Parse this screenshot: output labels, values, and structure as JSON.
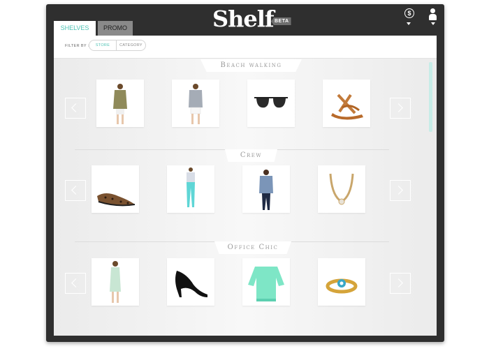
{
  "header": {
    "brand": "Shelf",
    "badge": "BETA"
  },
  "tabs": [
    {
      "label": "SHELVES"
    },
    {
      "label": "PROMO"
    }
  ],
  "filter": {
    "label": "FILTER BY :",
    "options": [
      "STORE",
      "CATEGORY"
    ],
    "selected": "STORE"
  },
  "shelves": [
    {
      "title": "Beach walking",
      "items": [
        {
          "name": "olive-utility-jacket-outfit"
        },
        {
          "name": "gray-cardigan-white-shorts-outfit"
        },
        {
          "name": "black-sunglasses"
        },
        {
          "name": "tan-strappy-sandals"
        }
      ]
    },
    {
      "title": "Crew",
      "items": [
        {
          "name": "leopard-print-flats"
        },
        {
          "name": "turquoise-skinny-pants"
        },
        {
          "name": "chambray-shirt-outfit"
        },
        {
          "name": "statement-necklace"
        }
      ]
    },
    {
      "title": "Office Chic",
      "items": [
        {
          "name": "mint-sheath-dress"
        },
        {
          "name": "black-patent-pumps"
        },
        {
          "name": "mint-sweater"
        },
        {
          "name": "jeweled-bracelet"
        }
      ]
    }
  ],
  "colors": {
    "accent": "#4fc3b5",
    "frame": "#2f2f2f"
  },
  "icons": [
    "coin-icon",
    "person-icon",
    "chevron-left-icon",
    "chevron-right-icon"
  ]
}
